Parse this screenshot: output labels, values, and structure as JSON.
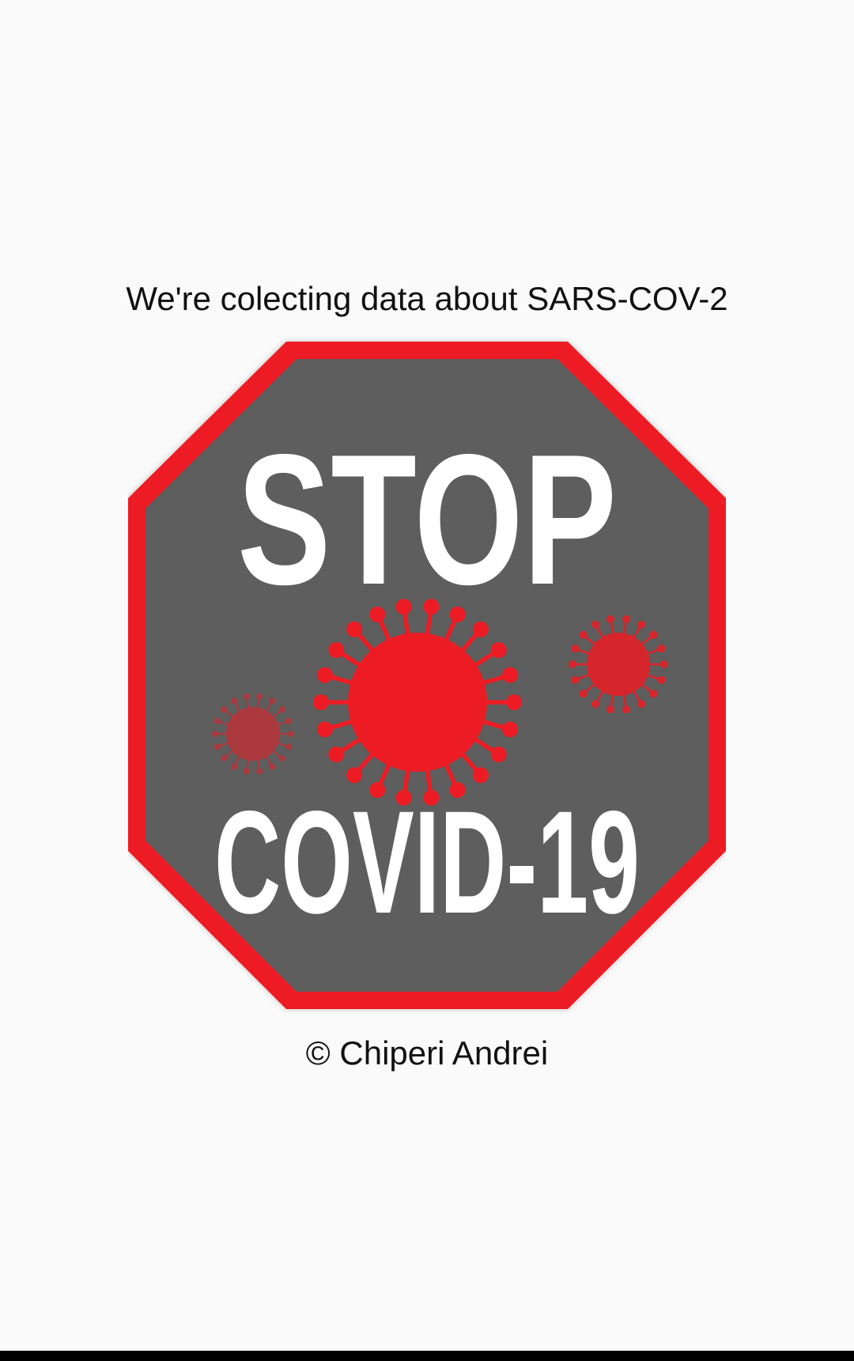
{
  "splash": {
    "loading_text": "We're colecting data about SARS-COV-2",
    "copyright_text": "© Chiperi Andrei"
  },
  "logo": {
    "line1": "STOP",
    "line2": "COVID-19",
    "icon": "virus-icon",
    "colors": {
      "border": "#ed1c24",
      "fill": "#5e5e5e",
      "text": "#ffffff",
      "virus": "#ed1c24"
    }
  },
  "system": {
    "nav_bar_color": "#000000"
  }
}
